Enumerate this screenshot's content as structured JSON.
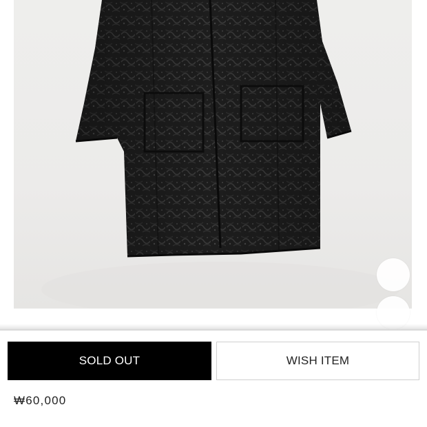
{
  "product": {
    "image_alt": "Black quilted coat",
    "gallery_dots": 2,
    "price": "₩60,000"
  },
  "actions": {
    "sold_out_label": "SOLD OUT",
    "wish_label": "WISH ITEM"
  },
  "colors": {
    "primary_button_bg": "#000000",
    "primary_button_text": "#ffffff",
    "secondary_button_border": "#cfcfcf",
    "text": "#222222"
  }
}
